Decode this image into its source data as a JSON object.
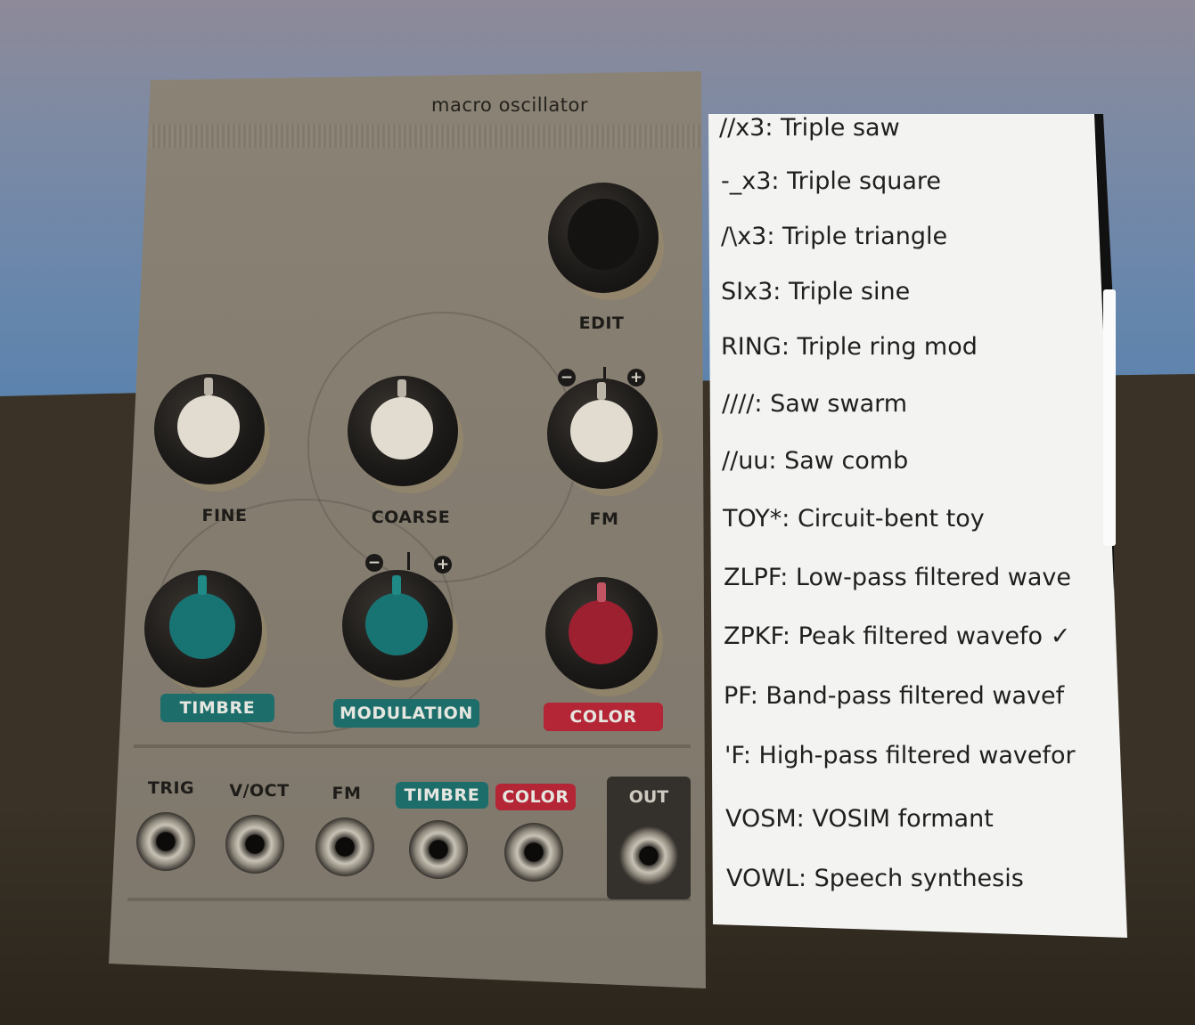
{
  "module": {
    "title": "macro oscillator",
    "knobs": {
      "edit": "EDIT",
      "fine": "FINE",
      "coarse": "COARSE",
      "fm": "FM",
      "timbre": "TIMBRE",
      "modulation": "MODULATION",
      "color": "COLOR"
    },
    "signs": {
      "minus": "−",
      "plus": "+"
    },
    "jacks": {
      "trig": "TRIG",
      "voct": "V/OCT",
      "fm": "FM",
      "timbre": "TIMBRE",
      "color": "COLOR",
      "out": "OUT"
    },
    "colors": {
      "teal": "#1d6e6b",
      "red": "#b42535"
    }
  },
  "menu": {
    "items": [
      {
        "label": "//x3: Triple saw"
      },
      {
        "label": "-_x3: Triple square"
      },
      {
        "label": "/\\x3: Triple triangle"
      },
      {
        "label": "SIx3: Triple sine"
      },
      {
        "label": "RING: Triple ring mod"
      },
      {
        "label": "////: Saw swarm"
      },
      {
        "label": "//uu: Saw comb"
      },
      {
        "label": "TOY*: Circuit-bent toy"
      },
      {
        "label": "ZLPF: Low-pass filtered wave"
      },
      {
        "label": "ZPKF: Peak filtered wavefo"
      },
      {
        "label": "PF: Band-pass filtered wavef"
      },
      {
        "label": "'F: High-pass filtered wavefor"
      },
      {
        "label": "VOSM: VOSIM formant"
      },
      {
        "label": "VOWL: Speech synthesis"
      }
    ],
    "checkmark": "✓"
  }
}
